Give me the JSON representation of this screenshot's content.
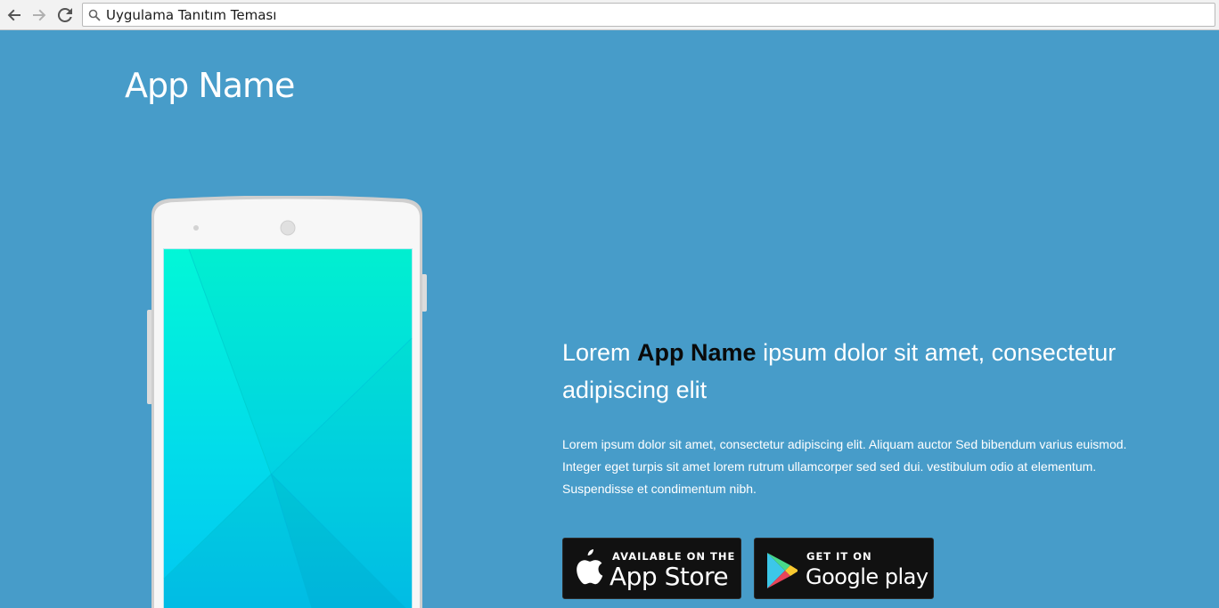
{
  "browser": {
    "address_text": "Uygulama Tanıtım Teması"
  },
  "hero": {
    "app_name": "App Name",
    "headline_before": "Lorem ",
    "headline_strong": "App Name",
    "headline_after": " ipsum dolor sit amet, consectetur adipiscing elit",
    "description": "Lorem ipsum dolor sit amet, consectetur adipiscing elit. Aliquam auctor Sed bibendum varius euismod. Integer eget turpis sit amet lorem rutrum ullamcorper sed sed dui. vestibulum odio at elementum. Suspendisse et condimentum nibh."
  },
  "stores": {
    "apple": {
      "small": "AVAILABLE ON THE",
      "big": "App Store",
      "icon": "apple-icon"
    },
    "google": {
      "small": "GET IT ON",
      "big": "Google play",
      "icon": "google-play-icon"
    }
  },
  "colors": {
    "background": "#479cc9",
    "headline_strong": "#0a0a0a",
    "store_button": "#111111"
  }
}
